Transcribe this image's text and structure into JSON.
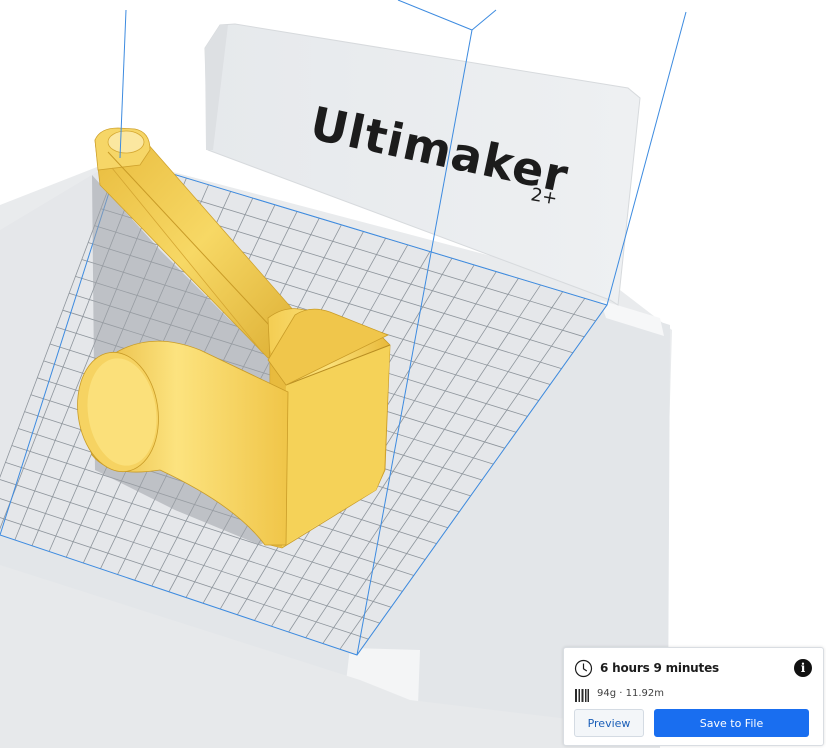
{
  "printer": {
    "brand_label": "Ultimaker",
    "model_suffix": "2+"
  },
  "scene": {
    "model_color": "#f3c94e",
    "build_volume_color": "#3d8be0",
    "grid_color": "#8f969d",
    "plate_color": "#e8eaec"
  },
  "print_info": {
    "time_icon": "clock-icon",
    "print_time": "6 hours 9 minutes",
    "info_icon": "info-icon",
    "info_glyph": "i",
    "material_icon": "filament-spool-icon",
    "material_usage": "94g · 11.92m"
  },
  "actions": {
    "preview_label": "Preview",
    "save_label": "Save to File"
  },
  "colors": {
    "accent": "#196ef0",
    "preview_text": "#1b5fb8"
  }
}
